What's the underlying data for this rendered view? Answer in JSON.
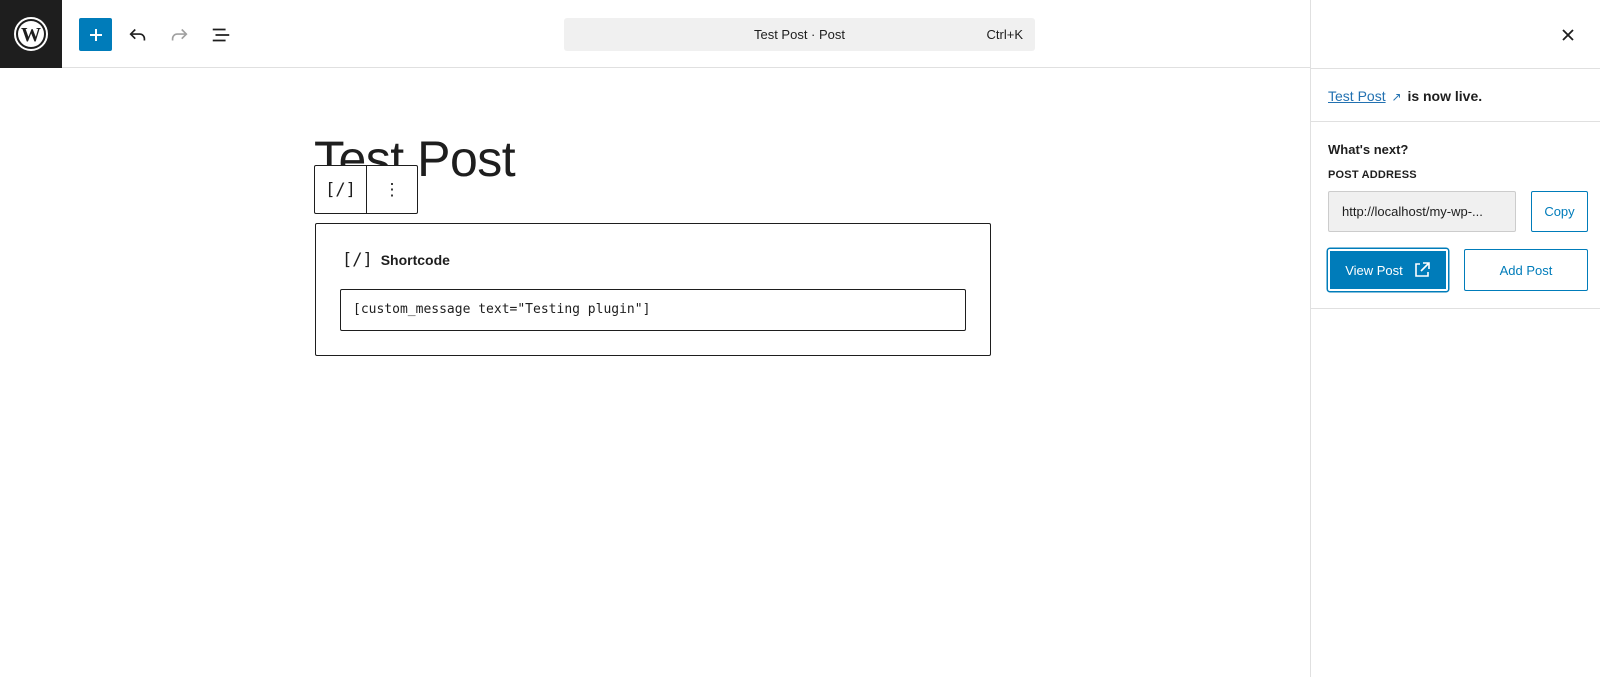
{
  "header": {
    "command_title": "Test Post · Post",
    "command_shortcut": "Ctrl+K",
    "icons": [
      "wordpress-logo",
      "plus-icon",
      "undo-icon",
      "redo-icon",
      "list-view-icon"
    ]
  },
  "editor": {
    "post_title": "Test Post",
    "block_toolbar": {
      "block_icon": "[/]",
      "options_icon": "⋮"
    },
    "shortcode_block": {
      "icon": "[/]",
      "label": "Shortcode",
      "value": "[custom_message text=\"Testing plugin\"]"
    }
  },
  "sidebar": {
    "close_icon": "✕",
    "live_link_text": "Test Post",
    "live_arrow": "↗",
    "live_suffix": " is now live.",
    "whats_next": "What's next?",
    "post_address_label": "POST ADDRESS",
    "post_address_value": "http://localhost/my-wp-...",
    "copy_label": "Copy",
    "view_post_label": "View Post",
    "add_post_label": "Add Post"
  },
  "colors": {
    "accent": "#007cba",
    "link": "#2271b1",
    "dark": "#1e1e1e"
  }
}
